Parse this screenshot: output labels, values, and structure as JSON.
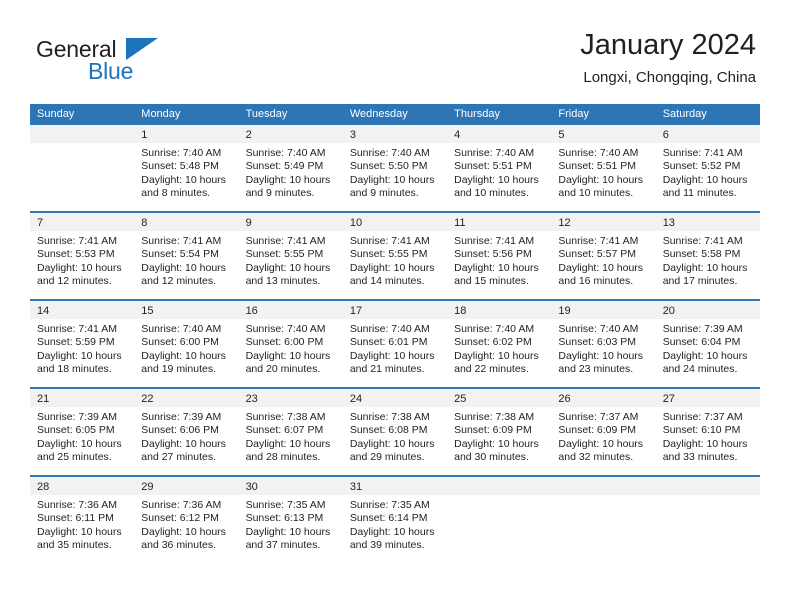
{
  "brand": {
    "name_part1": "General",
    "name_part2": "Blue",
    "accent_color": "#1e73be"
  },
  "header": {
    "title": "January 2024",
    "subtitle": "Longxi, Chongqing, China"
  },
  "theme": {
    "header_band_color": "#2e75b6",
    "day_number_band_color": "#f2f2f2",
    "text_color": "#231f20"
  },
  "weekdays": [
    "Sunday",
    "Monday",
    "Tuesday",
    "Wednesday",
    "Thursday",
    "Friday",
    "Saturday"
  ],
  "labels": {
    "sunrise_prefix": "Sunrise:",
    "sunset_prefix": "Sunset:",
    "daylight_prefix": "Daylight:"
  },
  "weeks": [
    [
      {
        "day": "",
        "sunrise": "",
        "sunset": "",
        "daylight_line1": "",
        "daylight_line2": ""
      },
      {
        "day": "1",
        "sunrise": "Sunrise: 7:40 AM",
        "sunset": "Sunset: 5:48 PM",
        "daylight_line1": "Daylight: 10 hours",
        "daylight_line2": "and 8 minutes."
      },
      {
        "day": "2",
        "sunrise": "Sunrise: 7:40 AM",
        "sunset": "Sunset: 5:49 PM",
        "daylight_line1": "Daylight: 10 hours",
        "daylight_line2": "and 9 minutes."
      },
      {
        "day": "3",
        "sunrise": "Sunrise: 7:40 AM",
        "sunset": "Sunset: 5:50 PM",
        "daylight_line1": "Daylight: 10 hours",
        "daylight_line2": "and 9 minutes."
      },
      {
        "day": "4",
        "sunrise": "Sunrise: 7:40 AM",
        "sunset": "Sunset: 5:51 PM",
        "daylight_line1": "Daylight: 10 hours",
        "daylight_line2": "and 10 minutes."
      },
      {
        "day": "5",
        "sunrise": "Sunrise: 7:40 AM",
        "sunset": "Sunset: 5:51 PM",
        "daylight_line1": "Daylight: 10 hours",
        "daylight_line2": "and 10 minutes."
      },
      {
        "day": "6",
        "sunrise": "Sunrise: 7:41 AM",
        "sunset": "Sunset: 5:52 PM",
        "daylight_line1": "Daylight: 10 hours",
        "daylight_line2": "and 11 minutes."
      }
    ],
    [
      {
        "day": "7",
        "sunrise": "Sunrise: 7:41 AM",
        "sunset": "Sunset: 5:53 PM",
        "daylight_line1": "Daylight: 10 hours",
        "daylight_line2": "and 12 minutes."
      },
      {
        "day": "8",
        "sunrise": "Sunrise: 7:41 AM",
        "sunset": "Sunset: 5:54 PM",
        "daylight_line1": "Daylight: 10 hours",
        "daylight_line2": "and 12 minutes."
      },
      {
        "day": "9",
        "sunrise": "Sunrise: 7:41 AM",
        "sunset": "Sunset: 5:55 PM",
        "daylight_line1": "Daylight: 10 hours",
        "daylight_line2": "and 13 minutes."
      },
      {
        "day": "10",
        "sunrise": "Sunrise: 7:41 AM",
        "sunset": "Sunset: 5:55 PM",
        "daylight_line1": "Daylight: 10 hours",
        "daylight_line2": "and 14 minutes."
      },
      {
        "day": "11",
        "sunrise": "Sunrise: 7:41 AM",
        "sunset": "Sunset: 5:56 PM",
        "daylight_line1": "Daylight: 10 hours",
        "daylight_line2": "and 15 minutes."
      },
      {
        "day": "12",
        "sunrise": "Sunrise: 7:41 AM",
        "sunset": "Sunset: 5:57 PM",
        "daylight_line1": "Daylight: 10 hours",
        "daylight_line2": "and 16 minutes."
      },
      {
        "day": "13",
        "sunrise": "Sunrise: 7:41 AM",
        "sunset": "Sunset: 5:58 PM",
        "daylight_line1": "Daylight: 10 hours",
        "daylight_line2": "and 17 minutes."
      }
    ],
    [
      {
        "day": "14",
        "sunrise": "Sunrise: 7:41 AM",
        "sunset": "Sunset: 5:59 PM",
        "daylight_line1": "Daylight: 10 hours",
        "daylight_line2": "and 18 minutes."
      },
      {
        "day": "15",
        "sunrise": "Sunrise: 7:40 AM",
        "sunset": "Sunset: 6:00 PM",
        "daylight_line1": "Daylight: 10 hours",
        "daylight_line2": "and 19 minutes."
      },
      {
        "day": "16",
        "sunrise": "Sunrise: 7:40 AM",
        "sunset": "Sunset: 6:00 PM",
        "daylight_line1": "Daylight: 10 hours",
        "daylight_line2": "and 20 minutes."
      },
      {
        "day": "17",
        "sunrise": "Sunrise: 7:40 AM",
        "sunset": "Sunset: 6:01 PM",
        "daylight_line1": "Daylight: 10 hours",
        "daylight_line2": "and 21 minutes."
      },
      {
        "day": "18",
        "sunrise": "Sunrise: 7:40 AM",
        "sunset": "Sunset: 6:02 PM",
        "daylight_line1": "Daylight: 10 hours",
        "daylight_line2": "and 22 minutes."
      },
      {
        "day": "19",
        "sunrise": "Sunrise: 7:40 AM",
        "sunset": "Sunset: 6:03 PM",
        "daylight_line1": "Daylight: 10 hours",
        "daylight_line2": "and 23 minutes."
      },
      {
        "day": "20",
        "sunrise": "Sunrise: 7:39 AM",
        "sunset": "Sunset: 6:04 PM",
        "daylight_line1": "Daylight: 10 hours",
        "daylight_line2": "and 24 minutes."
      }
    ],
    [
      {
        "day": "21",
        "sunrise": "Sunrise: 7:39 AM",
        "sunset": "Sunset: 6:05 PM",
        "daylight_line1": "Daylight: 10 hours",
        "daylight_line2": "and 25 minutes."
      },
      {
        "day": "22",
        "sunrise": "Sunrise: 7:39 AM",
        "sunset": "Sunset: 6:06 PM",
        "daylight_line1": "Daylight: 10 hours",
        "daylight_line2": "and 27 minutes."
      },
      {
        "day": "23",
        "sunrise": "Sunrise: 7:38 AM",
        "sunset": "Sunset: 6:07 PM",
        "daylight_line1": "Daylight: 10 hours",
        "daylight_line2": "and 28 minutes."
      },
      {
        "day": "24",
        "sunrise": "Sunrise: 7:38 AM",
        "sunset": "Sunset: 6:08 PM",
        "daylight_line1": "Daylight: 10 hours",
        "daylight_line2": "and 29 minutes."
      },
      {
        "day": "25",
        "sunrise": "Sunrise: 7:38 AM",
        "sunset": "Sunset: 6:09 PM",
        "daylight_line1": "Daylight: 10 hours",
        "daylight_line2": "and 30 minutes."
      },
      {
        "day": "26",
        "sunrise": "Sunrise: 7:37 AM",
        "sunset": "Sunset: 6:09 PM",
        "daylight_line1": "Daylight: 10 hours",
        "daylight_line2": "and 32 minutes."
      },
      {
        "day": "27",
        "sunrise": "Sunrise: 7:37 AM",
        "sunset": "Sunset: 6:10 PM",
        "daylight_line1": "Daylight: 10 hours",
        "daylight_line2": "and 33 minutes."
      }
    ],
    [
      {
        "day": "28",
        "sunrise": "Sunrise: 7:36 AM",
        "sunset": "Sunset: 6:11 PM",
        "daylight_line1": "Daylight: 10 hours",
        "daylight_line2": "and 35 minutes."
      },
      {
        "day": "29",
        "sunrise": "Sunrise: 7:36 AM",
        "sunset": "Sunset: 6:12 PM",
        "daylight_line1": "Daylight: 10 hours",
        "daylight_line2": "and 36 minutes."
      },
      {
        "day": "30",
        "sunrise": "Sunrise: 7:35 AM",
        "sunset": "Sunset: 6:13 PM",
        "daylight_line1": "Daylight: 10 hours",
        "daylight_line2": "and 37 minutes."
      },
      {
        "day": "31",
        "sunrise": "Sunrise: 7:35 AM",
        "sunset": "Sunset: 6:14 PM",
        "daylight_line1": "Daylight: 10 hours",
        "daylight_line2": "and 39 minutes."
      },
      {
        "day": "",
        "sunrise": "",
        "sunset": "",
        "daylight_line1": "",
        "daylight_line2": ""
      },
      {
        "day": "",
        "sunrise": "",
        "sunset": "",
        "daylight_line1": "",
        "daylight_line2": ""
      },
      {
        "day": "",
        "sunrise": "",
        "sunset": "",
        "daylight_line1": "",
        "daylight_line2": ""
      }
    ]
  ]
}
